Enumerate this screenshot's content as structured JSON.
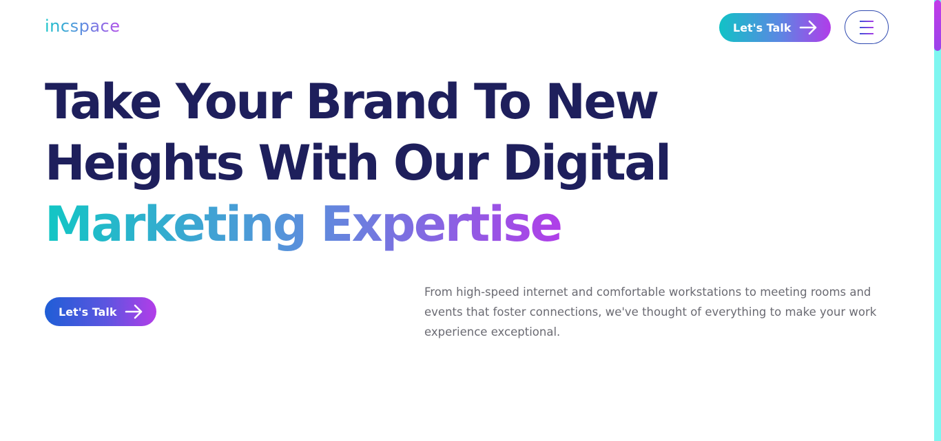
{
  "header": {
    "logo_text": "incspace",
    "cta_label": "Let's Talk",
    "menu_icon": "hamburger-menu-icon"
  },
  "hero": {
    "headline_line1": "Take Your Brand To New",
    "headline_line2": "Heights With Our Digital",
    "headline_line3": "Marketing Expertise",
    "cta_label": "Let's Talk",
    "description": "From high-speed internet and comfortable workstations to meeting rooms and events that foster connections, we've thought of everything to make your work experience exceptional."
  },
  "icons": {
    "arrow": "arrow-right-icon"
  },
  "colors": {
    "heading": "#1e1f5c",
    "gradient_start": "#12c6c4",
    "gradient_end": "#b03ee8",
    "body_text": "#6a6a72",
    "scrollbar_track": "#7ef6f0",
    "scrollbar_thumb": "#c23be8"
  }
}
